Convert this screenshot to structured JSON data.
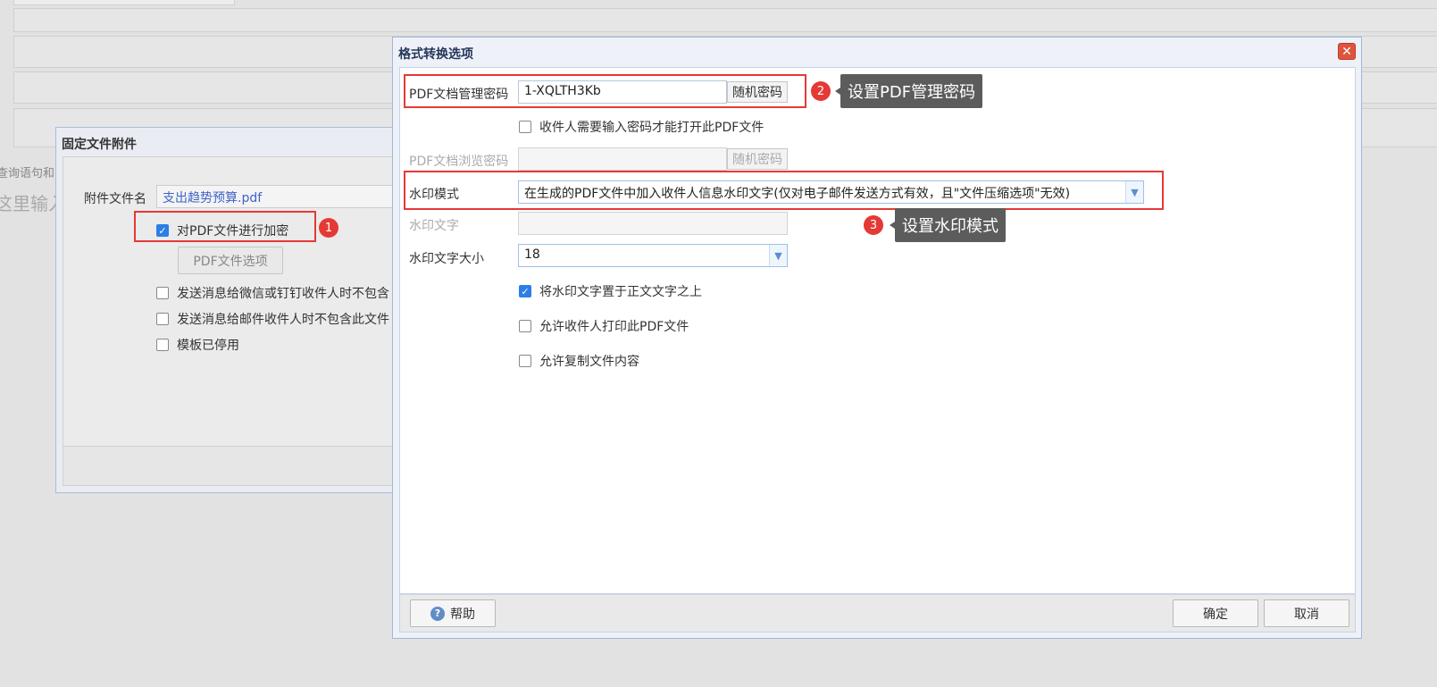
{
  "background": {
    "left_text_1": "查询语句和",
    "left_text_2": "这里输入"
  },
  "back_dialog": {
    "title": "固定文件附件",
    "attach_label": "附件文件名",
    "attach_value": "支出趋势预算.pdf",
    "encrypt_label": "对PDF文件进行加密",
    "pdf_options_button": "PDF文件选项",
    "opt_wechat": "发送消息给微信或钉钉收件人时不包含",
    "opt_mail": "发送消息给邮件收件人时不包含此文件",
    "opt_disabled": "模板已停用"
  },
  "dialog": {
    "title": "格式转换选项",
    "close_glyph": "✕",
    "admin_pwd_label": "PDF文档管理密码",
    "admin_pwd_value": "1-XQLTH3Kb",
    "random_pwd_button": "随机密码",
    "require_pwd_label": "收件人需要输入密码才能打开此PDF文件",
    "view_pwd_label": "PDF文档浏览密码",
    "view_random_button": "随机密码",
    "watermark_mode_label": "水印模式",
    "watermark_mode_value": "在生成的PDF文件中加入收件人信息水印文字(仅对电子邮件发送方式有效，且\"文件压缩选项\"无效)",
    "watermark_text_label": "水印文字",
    "watermark_size_label": "水印文字大小",
    "watermark_size_value": "18",
    "above_text_label": "将水印文字置于正文文字之上",
    "allow_print_label": "允许收件人打印此PDF文件",
    "allow_copy_label": "允许复制文件内容",
    "help_button": "帮助",
    "ok_button": "确定",
    "cancel_button": "取消"
  },
  "annotations": {
    "badge_1": "1",
    "badge_2": "2",
    "badge_3": "3",
    "tip_2": "设置PDF管理密码",
    "tip_3": "设置水印模式"
  },
  "colors": {
    "annotation_red": "#e53935",
    "checkbox_blue": "#2d7ee6",
    "tooltip_gray": "#5c5c5c"
  }
}
